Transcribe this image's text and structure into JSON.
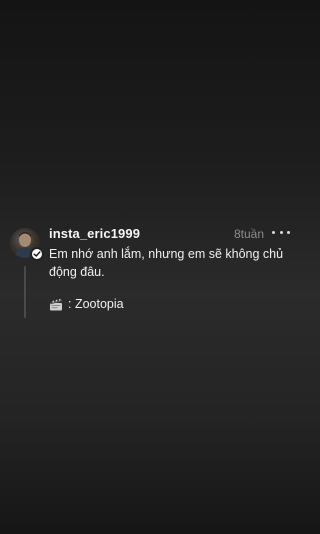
{
  "post": {
    "username": "insta_eric1999",
    "time": "8tuần",
    "text": "Em nhớ anh lắm, nhưng em sẽ không chủ động đâu.",
    "media_prefix": ": ",
    "media_title": "Zootopia",
    "icons": {
      "avatar": "profile-avatar",
      "badge": "checkmark-badge-icon",
      "more": "more-options-icon",
      "media": "clapperboard-icon"
    }
  },
  "colors": {
    "text": "#f0f0f0",
    "secondary": "#8e8e8e",
    "thread_line": "#4a4a4a"
  }
}
